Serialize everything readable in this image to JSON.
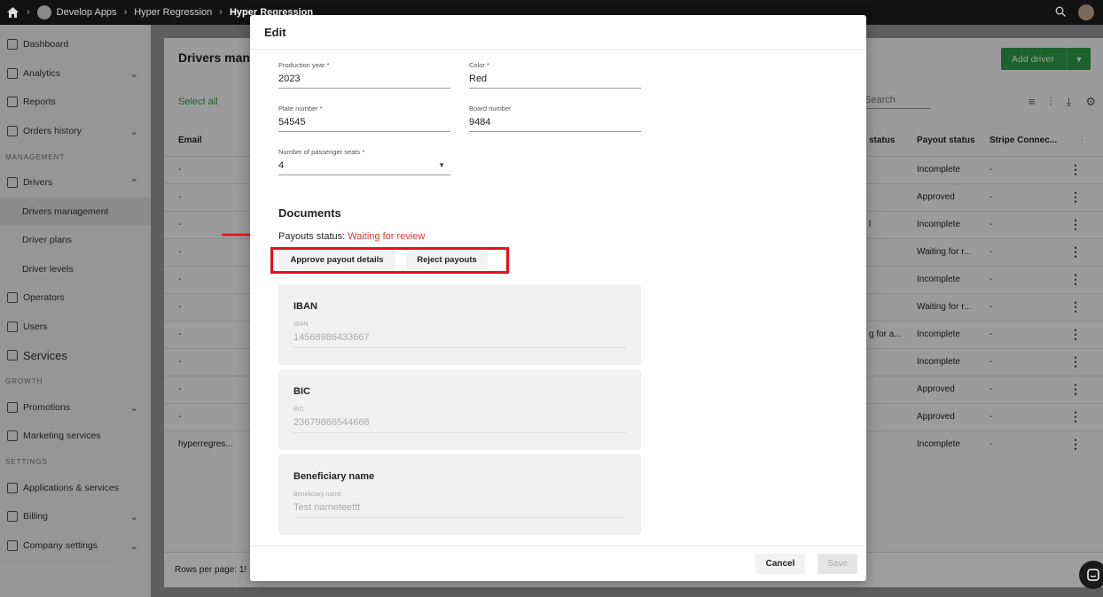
{
  "topbar": {
    "crumbs": [
      "Develop Apps",
      "Hyper Regression",
      "Hyper Regression"
    ]
  },
  "sidebar": {
    "items": [
      {
        "label": "Dashboard"
      },
      {
        "label": "Analytics"
      },
      {
        "label": "Reports"
      },
      {
        "label": "Orders history"
      }
    ],
    "section_management": "MANAGEMENT",
    "drivers": "Drivers",
    "drivers_sub": [
      "Drivers management",
      "Driver plans",
      "Driver levels"
    ],
    "operators": "Operators",
    "users": "Users",
    "services": "Services",
    "section_growth": "GROWTH",
    "promotions": "Promotions",
    "marketing": "Marketing services",
    "section_settings": "SETTINGS",
    "applications": "Applications & services",
    "billing": "Billing",
    "company_settings": "Company settings"
  },
  "main": {
    "title": "Drivers man",
    "add_driver": "Add driver",
    "select_all": "Select all",
    "search_placeholder": "Search",
    "columns": {
      "email": "Email",
      "status": "status",
      "payout_status": "Payout status",
      "stripe": "Stripe Connec..."
    },
    "rows": [
      {
        "email": "-",
        "status": "",
        "payout": "Incomplete",
        "stripe": "-"
      },
      {
        "email": "-",
        "status": "",
        "payout": "Approved",
        "stripe": "-"
      },
      {
        "email": "-",
        "status": "l",
        "payout": "Incomplete",
        "stripe": "-"
      },
      {
        "email": "-",
        "status": "",
        "payout": "Waiting for r...",
        "stripe": "-"
      },
      {
        "email": "-",
        "status": "",
        "payout": "Incomplete",
        "stripe": "-"
      },
      {
        "email": "-",
        "status": "",
        "payout": "Waiting for r...",
        "stripe": "-"
      },
      {
        "email": "-",
        "status": "g for a...",
        "payout": "Incomplete",
        "stripe": "-"
      },
      {
        "email": "-",
        "status": "",
        "payout": "Incomplete",
        "stripe": "-"
      },
      {
        "email": "-",
        "status": "",
        "payout": "Approved",
        "stripe": "-"
      },
      {
        "email": "-",
        "status": "",
        "payout": "Approved",
        "stripe": "-"
      },
      {
        "email": "hyperregres...",
        "status": "",
        "payout": "Incomplete",
        "stripe": "-"
      }
    ],
    "rows_per_page": "Rows per page:  1!"
  },
  "modal": {
    "title": "Edit",
    "production_year": {
      "label": "Production year *",
      "value": "2023"
    },
    "color": {
      "label": "Color *",
      "value": "Red"
    },
    "plate_number": {
      "label": "Plate number *",
      "value": "54545"
    },
    "board_number": {
      "label": "Board number",
      "value": "9484"
    },
    "passenger_seats": {
      "label": "Number of passenger seats *",
      "value": "4"
    },
    "documents_title": "Documents",
    "payout_status_label": "Payouts status:",
    "payout_status_value": "Waiting for review",
    "approve_button": "Approve payout details",
    "reject_button": "Reject payouts",
    "iban": {
      "title": "IBAN",
      "label": "IBAN",
      "value": "14568986433667"
    },
    "bic": {
      "title": "BIC",
      "label": "BIC",
      "value": "23679866544666"
    },
    "beneficiary": {
      "title": "Beneficiary name",
      "label": "Beneficiary name",
      "value": "Test nameteettt"
    },
    "cancel": "Cancel",
    "save": "Save"
  },
  "colors": {
    "accent_green": "#2e9e47",
    "warning_red": "#e53935",
    "highlight_red": "#e5101b"
  }
}
